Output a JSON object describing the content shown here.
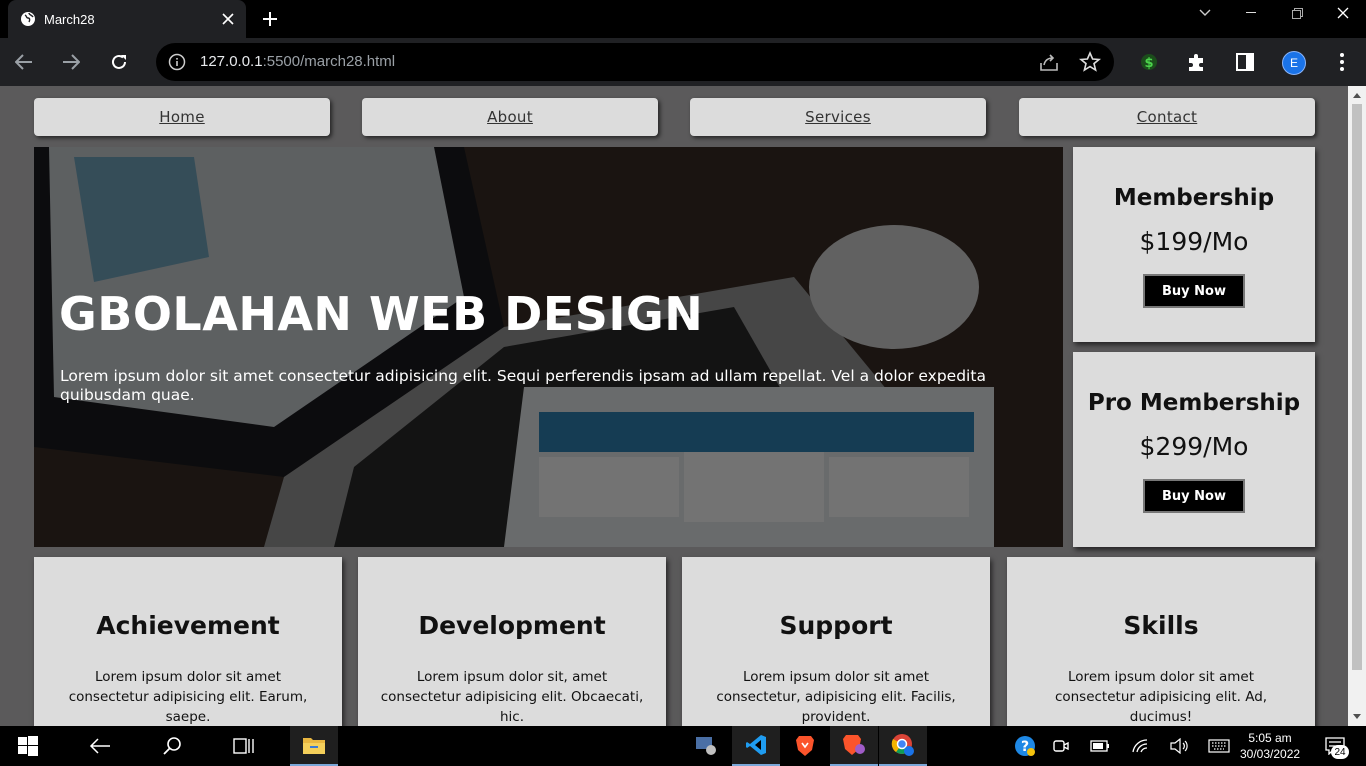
{
  "browser": {
    "tab_title": "March28",
    "url_host": "127.0.0.1",
    "url_rest": ":5500/march28.html",
    "profile_initial": "E"
  },
  "nav": {
    "items": [
      "Home",
      "About",
      "Services",
      "Contact"
    ]
  },
  "hero": {
    "title": "GBOLAHAN WEB DESIGN",
    "text": "Lorem ipsum dolor sit amet consectetur adipisicing elit. Sequi perferendis ipsam ad ullam repellat. Vel a dolor expedita quibusdam quae."
  },
  "pricing": [
    {
      "name": "Membership",
      "price": "$199/Mo",
      "button": "Buy Now"
    },
    {
      "name": "Pro Membership",
      "price": "$299/Mo",
      "button": "Buy Now"
    }
  ],
  "cards": [
    {
      "title": "Achievement",
      "text": "Lorem ipsum dolor sit amet consectetur adipisicing elit. Earum, saepe."
    },
    {
      "title": "Development",
      "text": "Lorem ipsum dolor sit, amet consectetur adipisicing elit. Obcaecati, hic."
    },
    {
      "title": "Support",
      "text": "Lorem ipsum dolor sit amet consectetur, adipisicing elit. Facilis, provident."
    },
    {
      "title": "Skills",
      "text": "Lorem ipsum dolor sit amet consectetur adipisicing elit. Ad, ducimus!"
    }
  ],
  "taskbar": {
    "time": "5:05 am",
    "date": "30/03/2022",
    "notification_count": "24"
  },
  "colors": {
    "page_bg": "#5b5a5b",
    "box_bg": "#dcdcdc",
    "button_bg": "#000000"
  }
}
